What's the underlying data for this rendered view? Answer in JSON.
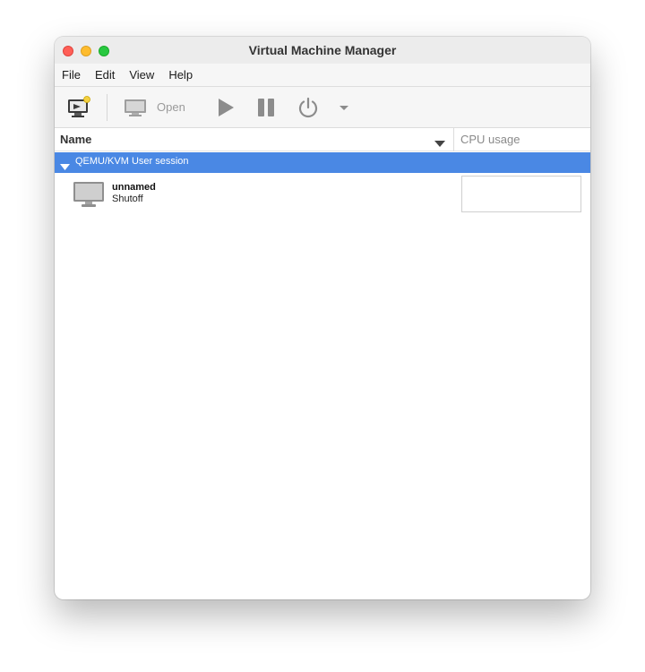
{
  "window": {
    "title": "Virtual Machine Manager"
  },
  "menu": [
    "File",
    "Edit",
    "View",
    "Help"
  ],
  "toolbar": {
    "open_label": "Open",
    "icons": [
      "new-vm-icon",
      "open-monitor-icon",
      "play-icon",
      "pause-icon",
      "power-icon",
      "dropdown-arrow-icon"
    ]
  },
  "columns": {
    "name": "Name",
    "cpu": "CPU usage"
  },
  "group": {
    "label": "QEMU/KVM User session"
  },
  "vms": [
    {
      "name": "unnamed",
      "status": "Shutoff"
    }
  ],
  "colors": {
    "selection": "#4a88e4",
    "close": "#ff5f57",
    "minimize": "#febc2e",
    "maximize": "#28c840"
  }
}
